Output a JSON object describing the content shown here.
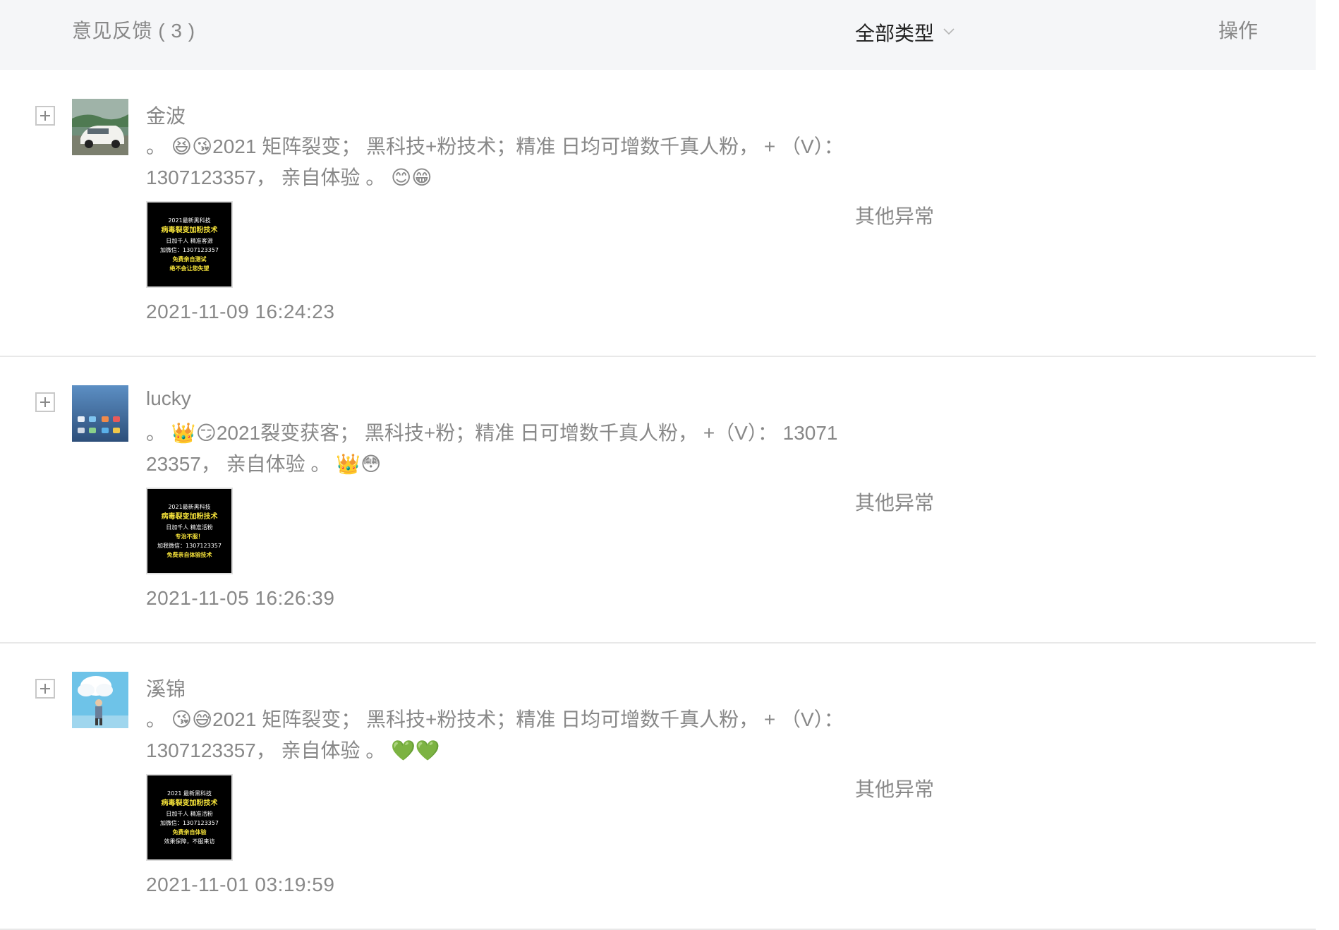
{
  "header": {
    "title": "意见反馈 ( 3 )",
    "filter_label": "全部类型",
    "action_label": "操作"
  },
  "rows": [
    {
      "username": "金波",
      "text": "。 😆😘2021 矩阵裂变； 黑科技+粉技术；精准 日均可增数千真人粉， + （V）： 1307123357， 亲自体验 。 😊😁",
      "thumb_lines": [
        "2021最新黑科技",
        "病毒裂变加粉技术",
        "日加千人  精准客源",
        "加微信：1307123357",
        "免费亲自测试",
        "绝不会让您失望"
      ],
      "timestamp": "2021-11-09 16:24:23",
      "type": "其他异常"
    },
    {
      "username": "lucky",
      "text": "。 👑😏2021裂变获客； 黑科技+粉；精准 日可增数千真人粉， +（V）： 1307123357， 亲自体验 。 👑😳",
      "thumb_lines": [
        "2021最新黑科技",
        "病毒裂变加粉技术",
        "日加千人  精准活粉",
        "专治不服！",
        "加我微信：1307123357",
        "免费亲自体验技术"
      ],
      "timestamp": "2021-11-05 16:26:39",
      "type": "其他异常"
    },
    {
      "username": "溪锦",
      "text": "。 😘😅2021 矩阵裂变； 黑科技+粉技术；精准 日均可增数千真人粉， + （V）： 1307123357， 亲自体验 。 💚💚",
      "thumb_lines": [
        "2021 最新黑科技",
        "病毒裂变加粉技术",
        "日加千人  精准活粉",
        "加微信：1307123357",
        "免费亲自体验",
        "效果保障，不服来访"
      ],
      "timestamp": "2021-11-01 03:19:59",
      "type": "其他异常"
    }
  ]
}
